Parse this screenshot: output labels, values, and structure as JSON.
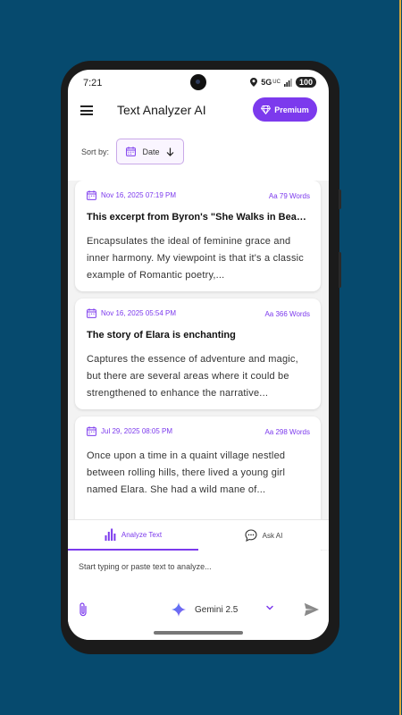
{
  "status_bar": {
    "time": "7:21",
    "network": "5G",
    "network_sub": "UC",
    "battery": "100"
  },
  "app_bar": {
    "title": "Text Analyzer AI",
    "premium_label": "Premium"
  },
  "sort": {
    "label": "Sort by:",
    "value": "Date"
  },
  "cards": [
    {
      "date": "Nov 16, 2025 07:19 PM",
      "word_count": "Aa 79 Words",
      "title": "This excerpt from Byron's \"She Walks in Beauty\"",
      "body": "Encapsulates the ideal of feminine grace and inner harmony. My viewpoint is that it's a classic example of Romantic poetry,..."
    },
    {
      "date": "Nov 16, 2025 05:54 PM",
      "word_count": "Aa 366 Words",
      "title": "The story of Elara is enchanting",
      "body": "Captures the essence of adventure and magic, but there are several areas where it could be strengthened to enhance the narrative..."
    },
    {
      "date": "Jul 29, 2025 08:05 PM",
      "word_count": "Aa 298 Words",
      "title": "",
      "body": "Once upon a time in a quaint village nestled between rolling hills, there lived a young girl named Elara. She had a wild mane of..."
    }
  ],
  "tabs": [
    {
      "label": "Analyze Text",
      "icon": "bar-chart-icon",
      "active": true
    },
    {
      "label": "Ask AI",
      "icon": "chat-bubble-icon",
      "active": false
    }
  ],
  "input": {
    "placeholder": "Start typing or paste text to analyze...",
    "value": ""
  },
  "model": {
    "name": "Gemini 2.5"
  },
  "colors": {
    "accent": "#7c3aed",
    "background": "#064a6e",
    "card": "#ffffff"
  }
}
